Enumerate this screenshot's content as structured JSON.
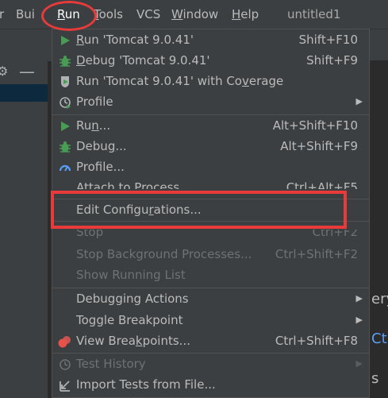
{
  "menubar": {
    "items": [
      {
        "label": "r",
        "underline": false
      },
      {
        "label": "Build",
        "prefix": "Bui",
        "underlined": "l",
        "suffix": "d"
      },
      {
        "label": "Run",
        "underlined": "R",
        "suffix": "un"
      },
      {
        "label": "Tools",
        "underlined": "T",
        "suffix": "ools"
      },
      {
        "label": "VCS"
      },
      {
        "label": "Window",
        "underlined": "W",
        "suffix": "indow"
      },
      {
        "label": "Help",
        "underlined": "H",
        "suffix": "elp"
      }
    ],
    "project_title": "untitled1"
  },
  "menu": {
    "items": [
      {
        "label": "Run 'Tomcat 9.0.41'",
        "m_pre": "",
        "m_u": "R",
        "m_post": "un 'Tomcat 9.0.41'",
        "shortcut": "Shift+F10",
        "icon": "run-icon"
      },
      {
        "label": "Debug 'Tomcat 9.0.41'",
        "m_pre": "",
        "m_u": "D",
        "m_post": "ebug 'Tomcat 9.0.41'",
        "shortcut": "Shift+F9",
        "icon": "debug-icon"
      },
      {
        "label": "Run 'Tomcat 9.0.41' with Coverage",
        "m_pre": "Run 'Tomcat 9.0.41' with Co",
        "m_u": "v",
        "m_post": "erage",
        "shortcut": "",
        "icon": "coverage-icon"
      },
      {
        "label": "Profile",
        "shortcut": "",
        "icon": "profile-icon",
        "submenu": true
      },
      {
        "label": "Run...",
        "m_pre": "Ru",
        "m_u": "n",
        "m_post": "...",
        "shortcut": "Alt+Shift+F10",
        "icon": "run-icon"
      },
      {
        "label": "Debug...",
        "m_pre": "Debu",
        "m_u": "g",
        "m_post": "...",
        "shortcut": "Alt+Shift+F9",
        "icon": "debug-icon"
      },
      {
        "label": "Profile...",
        "shortcut": "",
        "icon": "profiler-icon"
      },
      {
        "label": "Attach to Process...",
        "shortcut": "Ctrl+Alt+F5",
        "icon": ""
      },
      {
        "label": "Edit Configurations...",
        "m_pre": "Edit Configu",
        "m_u": "r",
        "m_post": "ations...",
        "shortcut": ""
      },
      {
        "label": "Stop",
        "shortcut": "Ctrl+F2",
        "disabled": true
      },
      {
        "label": "Stop Background Processes...",
        "shortcut": "Ctrl+Shift+F2",
        "disabled": true
      },
      {
        "label": "Show Running List",
        "shortcut": "",
        "disabled": true
      },
      {
        "label": "Debugging Actions",
        "submenu": true
      },
      {
        "label": "Toggle Breakpoint",
        "submenu": true
      },
      {
        "label": "View Breakpoints...",
        "m_pre": "View Brea",
        "m_u": "k",
        "m_post": "points...",
        "shortcut": "Ctrl+Shift+F8",
        "icon": "breakpoints-icon"
      },
      {
        "label": "Test History",
        "submenu": true,
        "disabled": true,
        "icon": "history-icon"
      },
      {
        "label": "Import Tests from File...",
        "icon": "import-icon"
      }
    ]
  },
  "background_text": {
    "right_1": "ery",
    "right_2": "Ct",
    "right_3": "s"
  },
  "colors": {
    "menu_bg": "#3c3f41",
    "text": "#bbbbbb",
    "disabled_text": "#6f7173",
    "run_green": "#499c54",
    "annotation_red": "#e83a3a",
    "link_blue": "#589df6"
  }
}
